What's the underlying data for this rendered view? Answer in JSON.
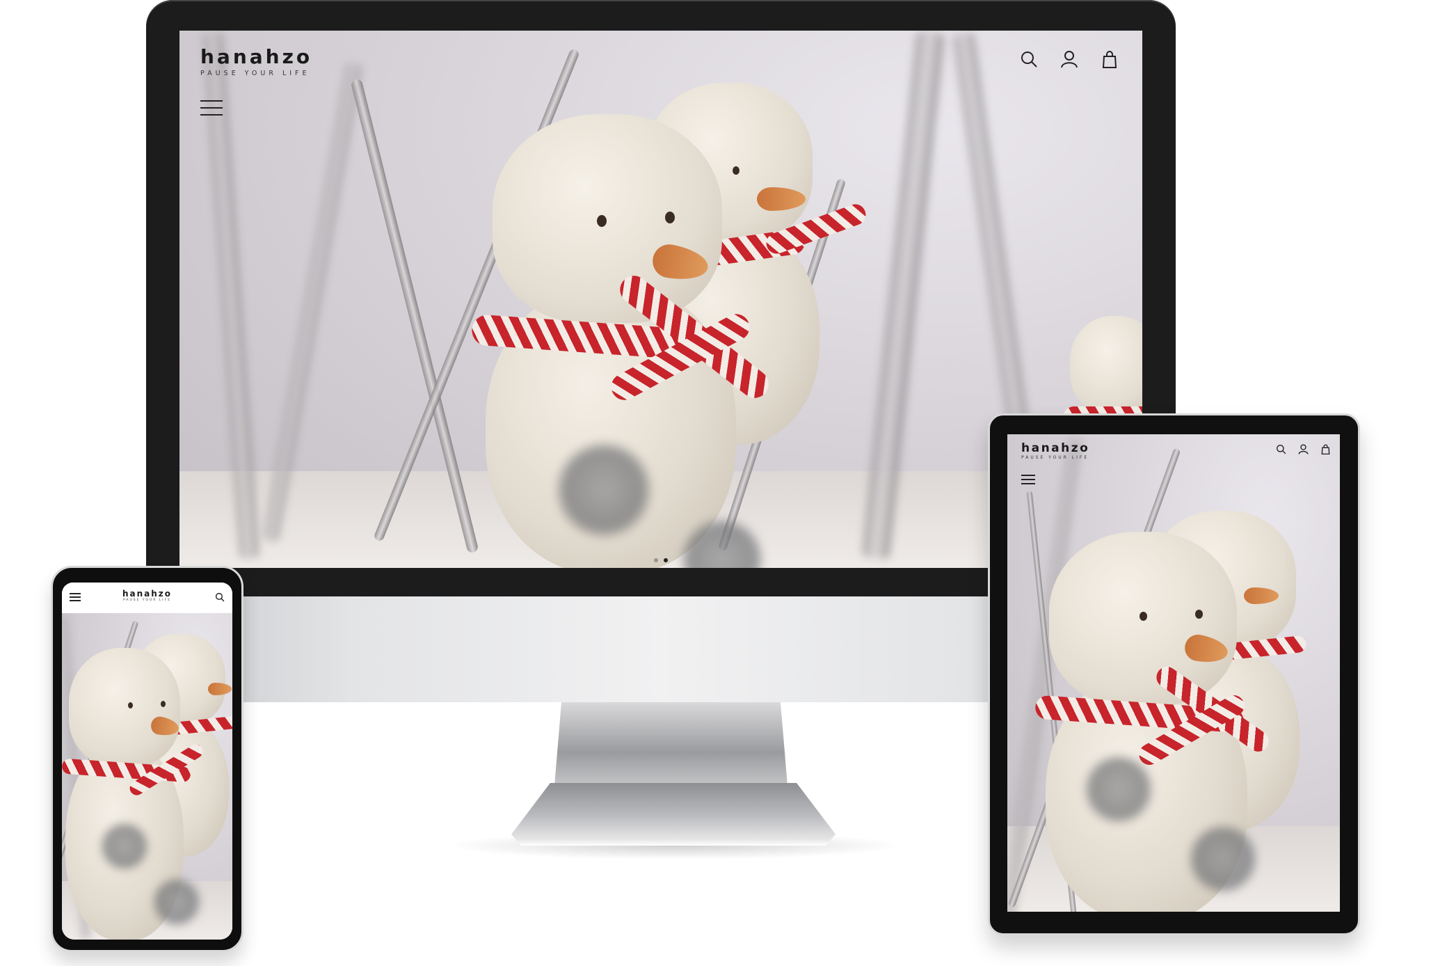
{
  "brand": {
    "name": "hanahzo",
    "tagline": "PAUSE YOUR LIFE"
  },
  "header": {
    "icons": [
      "search-icon",
      "account-icon",
      "cart-icon"
    ],
    "menu_icon": "menu-icon"
  },
  "hero": {
    "image_subject": "snowman soap figures with red and white scarves in snowy twigs",
    "slide_dots": [
      {
        "state": "inactive"
      },
      {
        "state": "active"
      }
    ]
  },
  "devices": [
    "desktop-monitor",
    "tablet",
    "phone"
  ],
  "colors": {
    "scarf_red": "#c8242b",
    "snowman_body": "#e9e2d6",
    "device_frame": "#1c1c1d",
    "text": "#1a1a1a"
  }
}
